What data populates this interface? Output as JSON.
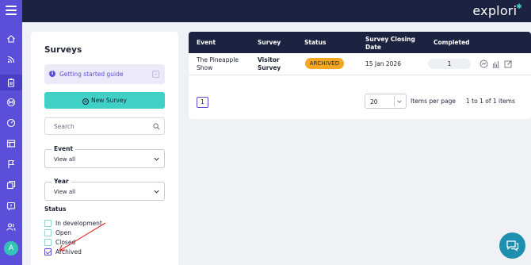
{
  "app": {
    "logo": "explori"
  },
  "rail": {
    "icons": [
      "home-icon",
      "rss-icon",
      "clipboard-icon",
      "target-icon",
      "gauge-icon",
      "layout-icon",
      "flag-icon",
      "copy-icon",
      "alert-icon",
      "users-icon"
    ],
    "avatar": "A"
  },
  "sidebar": {
    "title": "Surveys",
    "guide": "Getting started guide",
    "new_survey": "New Survey",
    "search_placeholder": "Search",
    "event_label": "Event",
    "event_value": "View all",
    "year_label": "Year",
    "year_value": "View all",
    "status_heading": "Status",
    "statuses": [
      {
        "label": "In development",
        "checked": false
      },
      {
        "label": "Open",
        "checked": false
      },
      {
        "label": "Closed",
        "checked": false
      },
      {
        "label": "Archived",
        "checked": true
      }
    ]
  },
  "table": {
    "headers": {
      "event": "Event",
      "survey": "Survey",
      "status": "Status",
      "closing_1": "Survey Closing",
      "closing_2": "Date",
      "completed": "Completed"
    },
    "rows": [
      {
        "event_1": "The Pineapple",
        "event_2": "Show",
        "survey_1": "Visitor",
        "survey_2": "Survey",
        "status": "ARCHIVED",
        "closing": "15 Jan 2026",
        "completed": "1"
      }
    ],
    "actions": [
      "results-icon",
      "chart-icon",
      "edit-icon"
    ],
    "page": "1",
    "per_page": "20",
    "per_page_label": "Items per page",
    "range": "1 to 1 of 1 items"
  },
  "colors": {
    "topbar": "#1c2340",
    "rail": "#5b4fd9",
    "accent": "#3fd1c5",
    "archived": "#f5a623",
    "chat": "#1f8fb0"
  }
}
